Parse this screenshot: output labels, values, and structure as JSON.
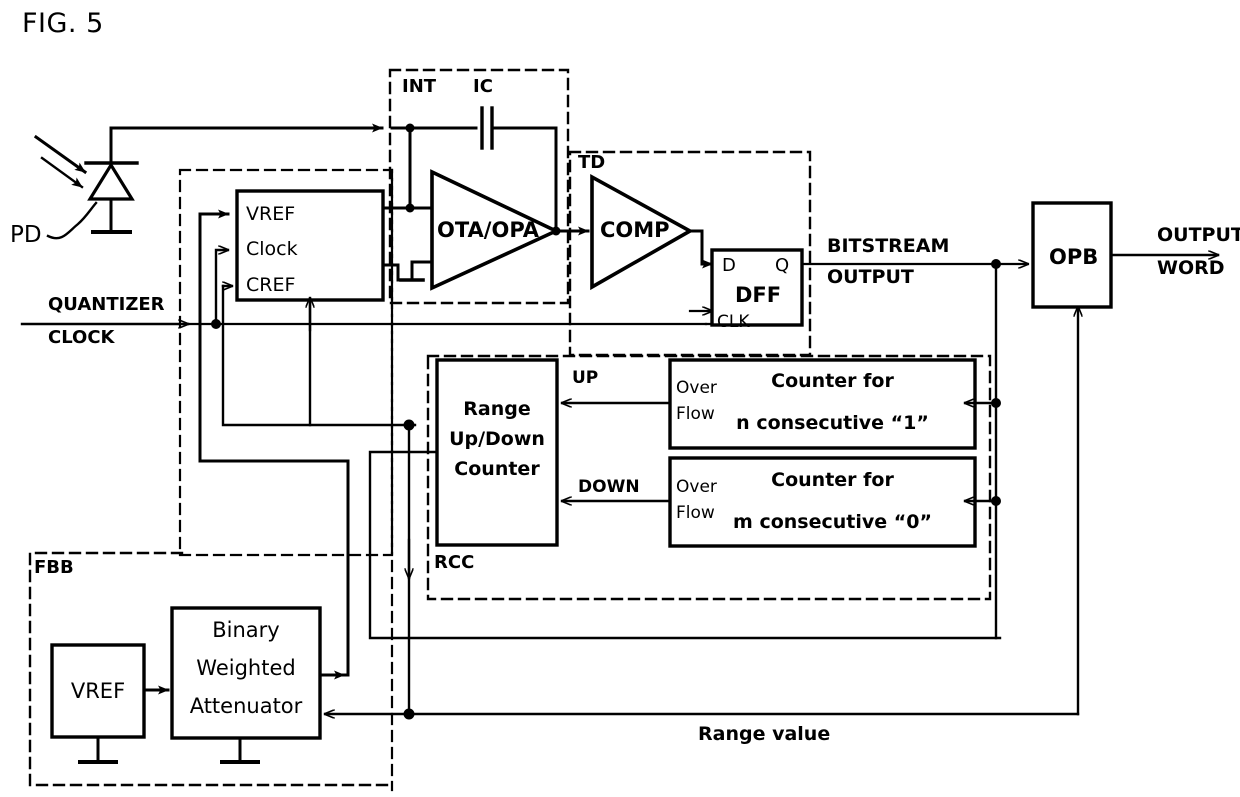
{
  "figure": {
    "title": "FIG. 5"
  },
  "labels": {
    "pd": "PD",
    "quantizer_clock_line1": "QUANTIZER",
    "quantizer_clock_line2": "CLOCK",
    "int": "INT",
    "ic": "IC",
    "td": "TD",
    "rcc": "RCC",
    "fbb": "FBB",
    "bitstream_line1": "BITSTREAM",
    "bitstream_line2": "OUTPUT",
    "output_word_line1": "OUTPUT",
    "output_word_line2": "WORD",
    "range_value": "Range value",
    "up": "UP",
    "down": "DOWN"
  },
  "blocks": {
    "quantizer": {
      "ports": [
        "VREF",
        "Clock",
        "CREF"
      ]
    },
    "ota": {
      "label": "OTA/OPA"
    },
    "comp": {
      "label": "COMP"
    },
    "dff": {
      "label": "DFF",
      "port_d": "D",
      "port_q": "Q",
      "port_clk": "CLK"
    },
    "opb": {
      "label": "OPB"
    },
    "range_counter": {
      "line1": "Range",
      "line2": "Up/Down",
      "line3": "Counter"
    },
    "counter_ones": {
      "overflow_line1": "Over",
      "overflow_line2": "Flow",
      "line1": "Counter for",
      "line2": "n consecutive “1”"
    },
    "counter_zeros": {
      "overflow_line1": "Over",
      "overflow_line2": "Flow",
      "line1": "Counter for",
      "line2": "m consecutive “0”"
    },
    "vref": {
      "label": "VREF"
    },
    "attenuator": {
      "line1": "Binary",
      "line2": "Weighted",
      "line3": "Attenuator"
    }
  },
  "colors": {
    "stroke": "#000000",
    "background": "#ffffff"
  }
}
